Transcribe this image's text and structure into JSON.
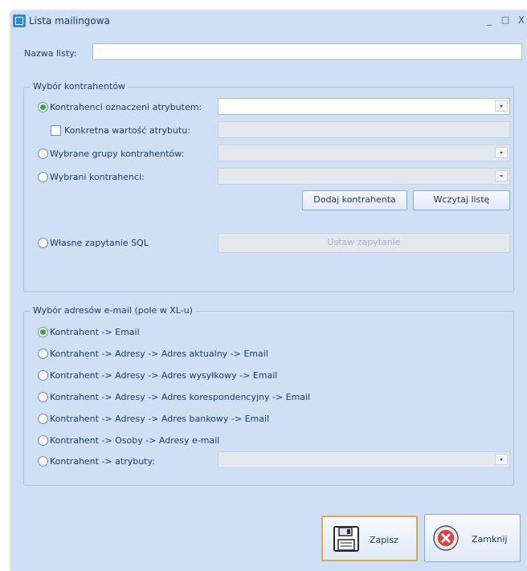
{
  "window": {
    "title": "Lista mailingowa",
    "minimize": "_",
    "maximize": "□",
    "close": "X"
  },
  "list_name": {
    "label": "Nazwa listy:",
    "value": ""
  },
  "contractors_group": {
    "title": "Wybór kontrahentów",
    "attr_marked_label": "Kontrahenci oznaczeni atrybutem:",
    "attr_marked_value": "",
    "specific_value_label": "Konkretna wartość atrybutu:",
    "specific_value_checked": false,
    "groups_label": "Wybrane grupy kontrahentów:",
    "selected_label": "Wybrani kontrahenci:",
    "add_contractor_button": "Dodaj kontrahenta",
    "load_list_button": "Wczytaj listę",
    "sql_label": "Własne zapytanie SQL",
    "set_query_button": "Ustaw zapytanie",
    "selected_option": "attr_marked"
  },
  "email_group": {
    "title": "Wybór adresów e-mail (pole w XL-u)",
    "options": [
      "Kontrahent -> Email",
      "Kontrahent -> Adresy -> Adres aktualny -> Email",
      "Kontrahent -> Adresy -> Adres wysyłkowy -> Email",
      "Kontrahent -> Adresy -> Adres korespondencyjny -> Email",
      "Kontrahent -> Adresy -> Adres bankowy -> Email",
      "Kontrahent -> Osoby -> Adresy e-mail",
      "Kontrahent -> atrybuty:"
    ],
    "selected_index": 0
  },
  "footer": {
    "save_label": "Zapisz",
    "close_label": "Zamknij"
  },
  "colors": {
    "window_bg": "#cfe0f5",
    "radio_checked": "#3aa53f",
    "focus_border": "#e3a64d",
    "close_icon": "#e0403c"
  },
  "icons": {
    "app": "mailing-list-icon",
    "save": "floppy-disk-icon",
    "close": "close-circle-icon"
  }
}
